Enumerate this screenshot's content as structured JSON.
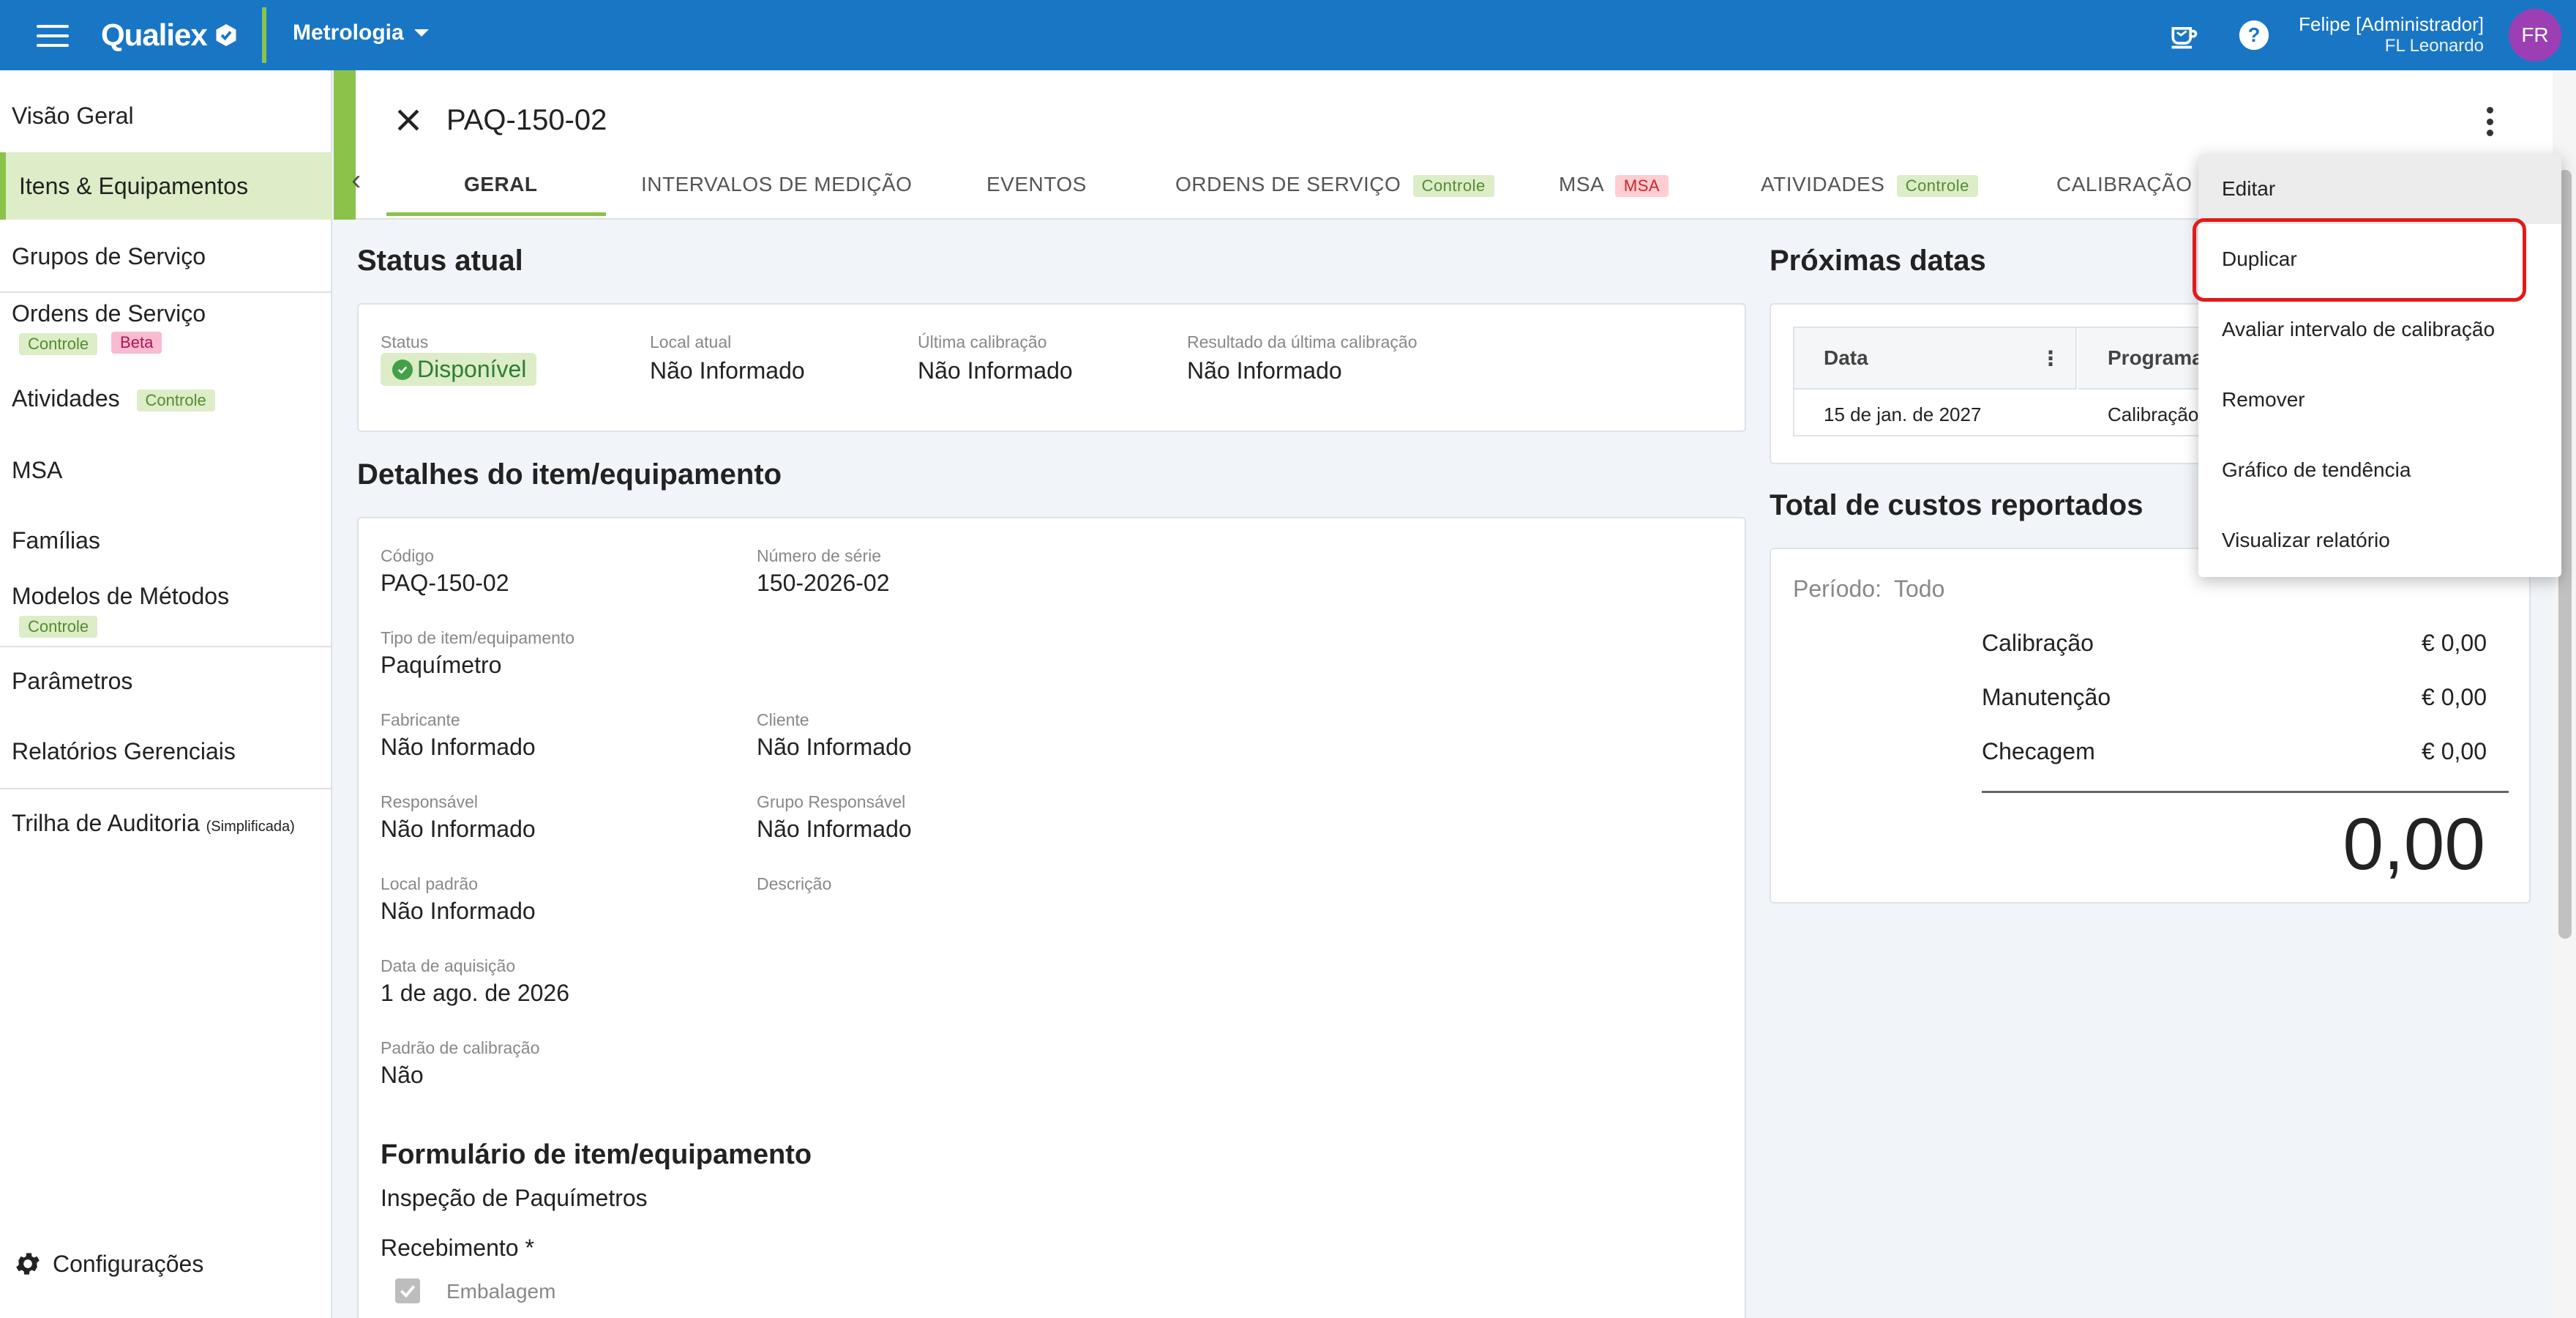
{
  "app": {
    "logo": "Qualiex",
    "module": "Metrologia"
  },
  "user": {
    "name": "Felipe [Administrador]",
    "company": "FL Leonardo",
    "initials": "FR"
  },
  "sidebar": {
    "items": [
      {
        "label": "Visão Geral"
      },
      {
        "label": "Itens & Equipamentos"
      },
      {
        "label": "Grupos de Serviço"
      },
      {
        "label": "Ordens de Serviço",
        "chips": [
          "Controle",
          "Beta"
        ]
      },
      {
        "label": "Atividades",
        "chips": [
          "Controle"
        ]
      },
      {
        "label": "MSA"
      },
      {
        "label": "Famílias"
      },
      {
        "label": "Modelos de Métodos",
        "chips": [
          "Controle"
        ]
      },
      {
        "label": "Parâmetros"
      },
      {
        "label": "Relatórios Gerenciais"
      },
      {
        "label": "Trilha de Auditoria",
        "suffix": "(Simplificada)"
      }
    ],
    "settings": "Configurações"
  },
  "header": {
    "title": "PAQ-150-02",
    "tabs": [
      {
        "label": "GERAL"
      },
      {
        "label": "INTERVALOS DE MEDIÇÃO"
      },
      {
        "label": "EVENTOS"
      },
      {
        "label": "ORDENS DE SERVIÇO",
        "chip": "Controle"
      },
      {
        "label": "MSA",
        "chip": "MSA"
      },
      {
        "label": "ATIVIDADES",
        "chip": "Controle"
      },
      {
        "label": "CALIBRAÇÃO"
      }
    ]
  },
  "status": {
    "title": "Status atual",
    "fields": [
      {
        "label": "Status",
        "value": "Disponível"
      },
      {
        "label": "Local atual",
        "value": "Não Informado"
      },
      {
        "label": "Última calibração",
        "value": "Não Informado"
      },
      {
        "label": "Resultado da última calibração",
        "value": "Não Informado"
      }
    ]
  },
  "details": {
    "title": "Detalhes do item/equipamento",
    "fields": [
      {
        "label": "Código",
        "value": "PAQ-150-02"
      },
      {
        "label": "Número de série",
        "value": "150-2026-02"
      },
      {
        "label": "Tipo de item/equipamento",
        "value": "Paquímetro"
      },
      {
        "label": "Fabricante",
        "value": "Não Informado"
      },
      {
        "label": "Cliente",
        "value": "Não Informado"
      },
      {
        "label": "Responsável",
        "value": "Não Informado"
      },
      {
        "label": "Grupo Responsável",
        "value": "Não Informado"
      },
      {
        "label": "Local padrão",
        "value": "Não Informado"
      },
      {
        "label": "Descrição",
        "value": ""
      },
      {
        "label": "Data de aquisição",
        "value": "1 de ago. de 2026"
      },
      {
        "label": "Padrão de calibração",
        "value": "Não"
      }
    ]
  },
  "form": {
    "title": "Formulário de item/equipamento",
    "name": "Inspeção de Paquímetros",
    "section": "Recebimento *",
    "checkbox": "Embalagem"
  },
  "next_dates": {
    "title": "Próximas datas",
    "columns": [
      "Data",
      "Programa"
    ],
    "rows": [
      [
        "15 de jan. de 2027",
        "Calibração"
      ]
    ]
  },
  "costs": {
    "title": "Total de custos reportados",
    "period_label": "Período:",
    "period_value": "Todo",
    "rows": [
      {
        "label": "Calibração",
        "value": "€ 0,00"
      },
      {
        "label": "Manutenção",
        "value": "€ 0,00"
      },
      {
        "label": "Checagem",
        "value": "€ 0,00"
      }
    ],
    "total": "0,00"
  },
  "menu": {
    "items": [
      "Editar",
      "Duplicar",
      "Avaliar intervalo de calibração",
      "Remover",
      "Gráfico de tendência",
      "Visualizar relatório"
    ]
  },
  "colors": {
    "primary": "#1976c5",
    "accent": "#8bc34a",
    "highlight": "#e01a1a",
    "avatar": "#9c3fb5"
  }
}
